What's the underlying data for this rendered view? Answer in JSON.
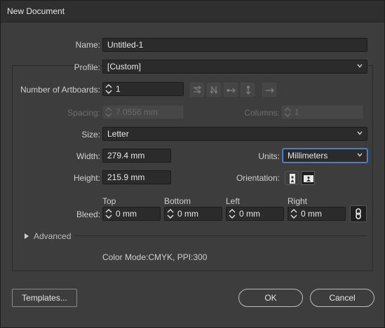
{
  "window": {
    "title": "New Document"
  },
  "name": {
    "label": "Name:",
    "value": "Untitled-1"
  },
  "profile": {
    "label": "Profile:",
    "value": "[Custom]"
  },
  "artboards": {
    "label": "Number of Artboards:",
    "value": "1"
  },
  "spacing": {
    "label": "Spacing:",
    "value": "7.0556 mm"
  },
  "columns": {
    "label": "Columns:",
    "value": "1"
  },
  "size": {
    "label": "Size:",
    "value": "Letter"
  },
  "width": {
    "label": "Width:",
    "value": "279.4 mm"
  },
  "units": {
    "label": "Units:",
    "value": "Millimeters"
  },
  "height": {
    "label": "Height:",
    "value": "215.9 mm"
  },
  "orientation": {
    "label": "Orientation:"
  },
  "bleed": {
    "label": "Bleed:",
    "top_label": "Top",
    "bottom_label": "Bottom",
    "left_label": "Left",
    "right_label": "Right",
    "top": "0 mm",
    "bottom": "0 mm",
    "left": "0 mm",
    "right": "0 mm"
  },
  "advanced": {
    "label": "Advanced"
  },
  "info": {
    "color_mode": "Color Mode:CMYK, PPI:300"
  },
  "buttons": {
    "templates": "Templates...",
    "ok": "OK",
    "cancel": "Cancel"
  },
  "colors": {
    "background": "#3d3d3d",
    "field": "#2b2b2b",
    "focus": "#5b8fd6",
    "text": "#cfcfcf"
  },
  "icons": [
    "grid-by-row-icon",
    "grid-by-column-icon",
    "arrange-by-row-icon",
    "arrange-by-column-icon",
    "right-to-left-icon",
    "portrait-icon",
    "landscape-icon",
    "link-icon",
    "expand-triangle-icon"
  ]
}
